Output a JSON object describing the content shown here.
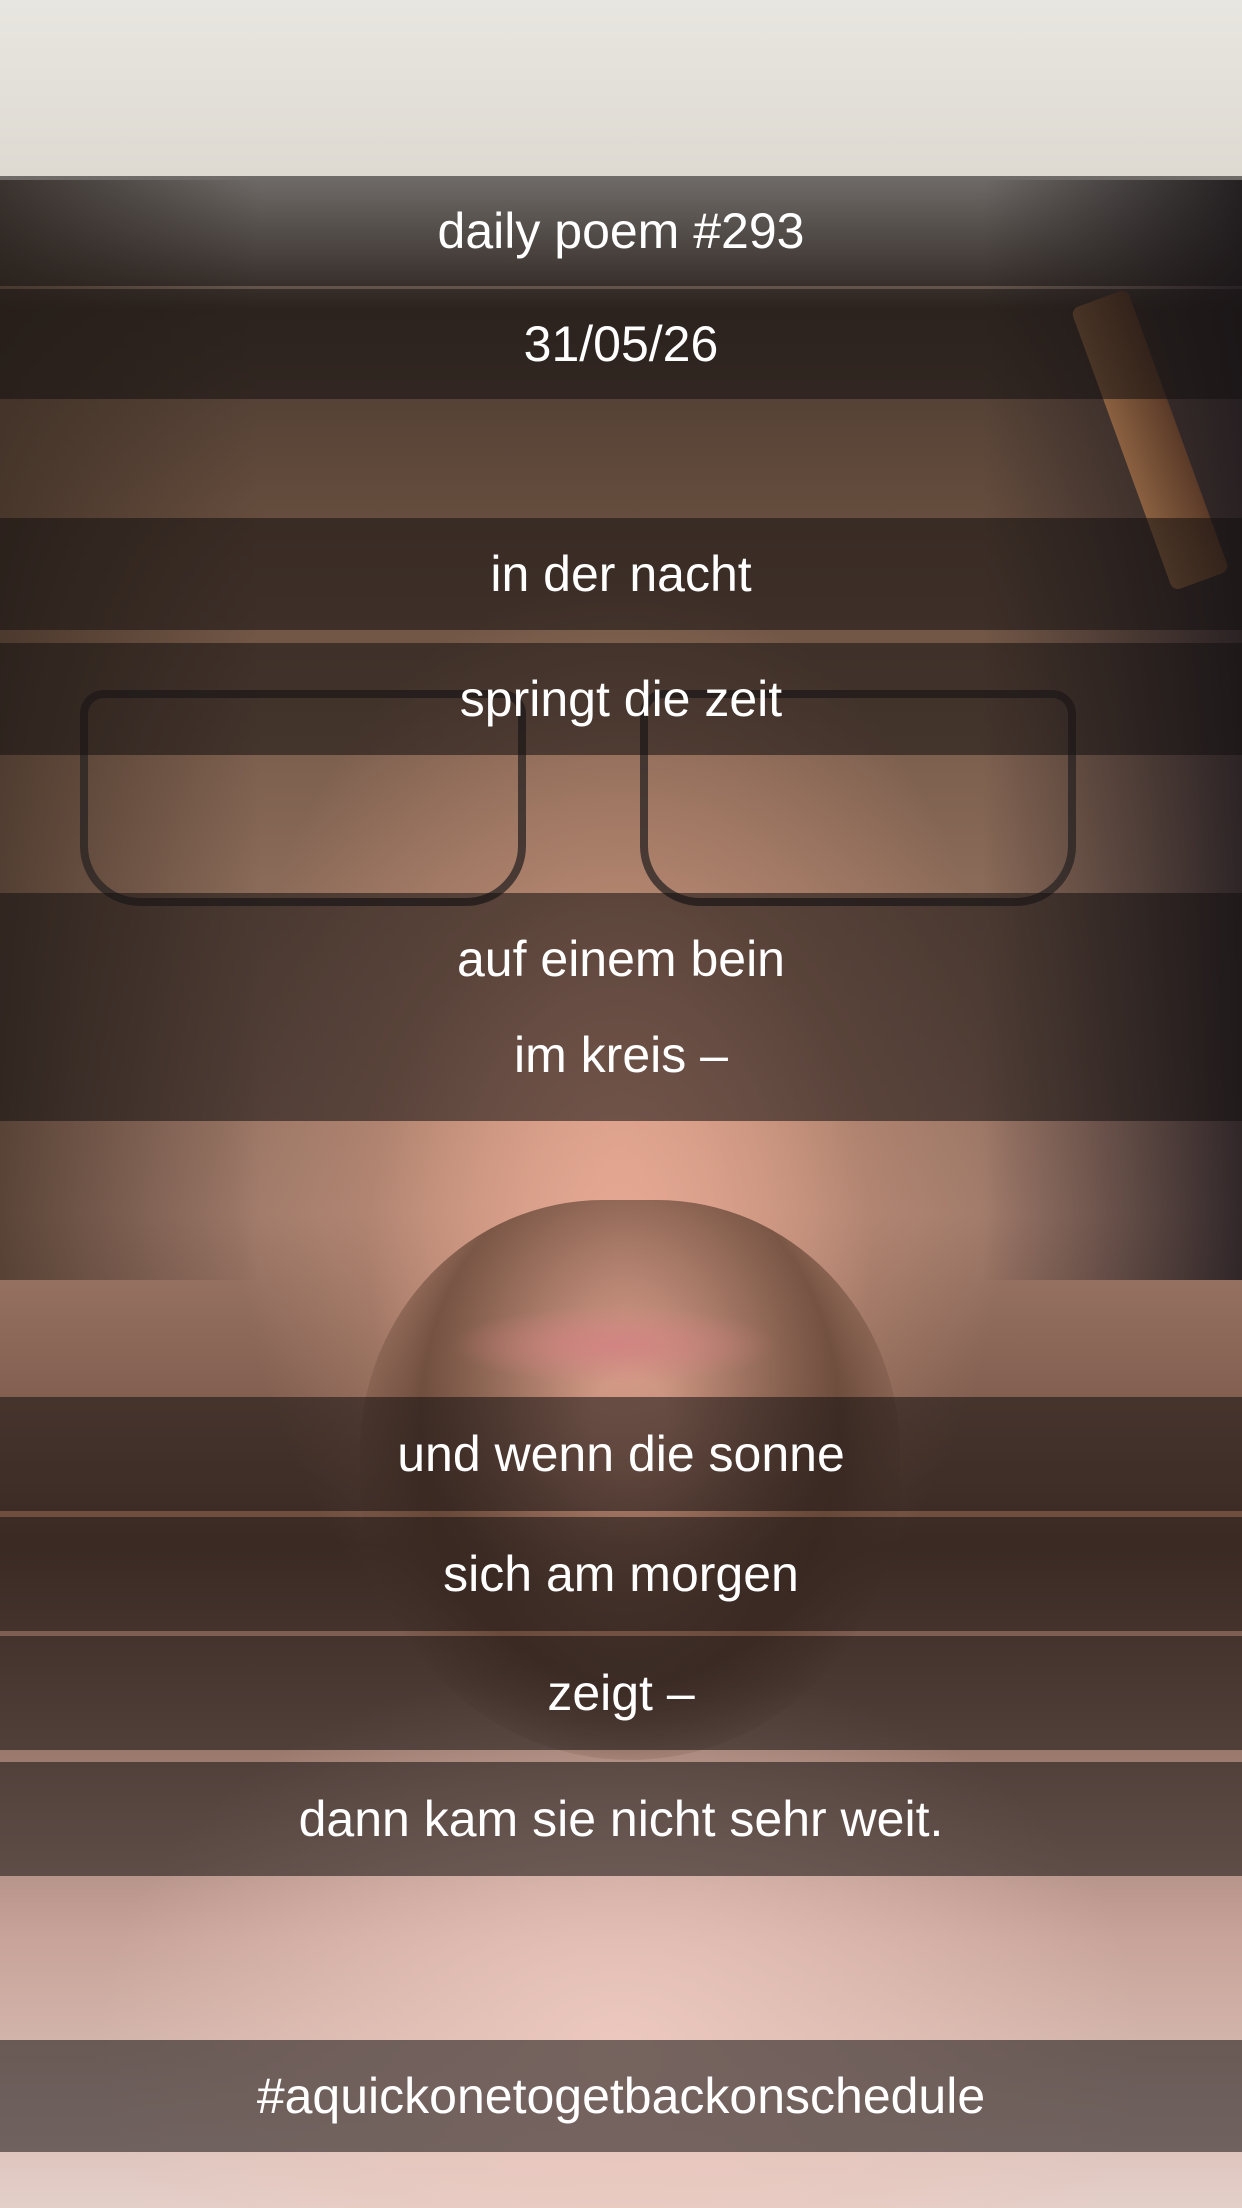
{
  "header": {
    "title": "daily poem #293",
    "date": "31/05/26"
  },
  "poem": {
    "lines": [
      "in der nacht",
      "springt die zeit",
      "auf einem bein",
      "im kreis –",
      "und wenn die sonne",
      "sich am morgen",
      "zeigt –",
      "dann kam sie nicht sehr weit."
    ]
  },
  "footer": {
    "hashtag": "#aquickonetogetbackonschedule"
  }
}
